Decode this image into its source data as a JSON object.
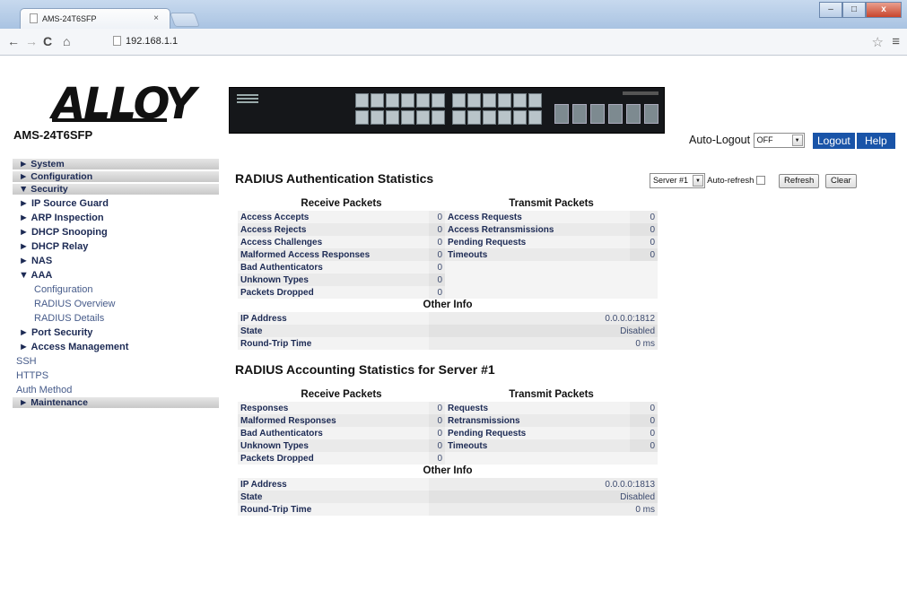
{
  "browser": {
    "tab_title": "AMS-24T6SFP",
    "tab_close": "×",
    "url": "192.168.1.1",
    "controls": {
      "back": "←",
      "forward": "→",
      "reload": "C",
      "home": "⌂",
      "star": "☆",
      "menu": "≡"
    },
    "window_buttons": {
      "minimize": "–",
      "maximize": "□",
      "close": "x"
    }
  },
  "header": {
    "logo_text": "ALLOY",
    "model": "AMS-24T6SFP",
    "auto_logout_label": "Auto-Logout",
    "auto_logout_value": "OFF",
    "logout_label": "Logout",
    "help_label": "Help"
  },
  "nav": {
    "system": "► System",
    "configuration": "► Configuration",
    "security": "▼ Security",
    "ip_source_guard": "► IP Source Guard",
    "arp_inspection": "► ARP Inspection",
    "dhcp_snooping": "► DHCP Snooping",
    "dhcp_relay": "► DHCP Relay",
    "nas": "► NAS",
    "aaa": "▼ AAA",
    "aaa_configuration": "Configuration",
    "radius_overview": "RADIUS Overview",
    "radius_details": "RADIUS Details",
    "port_security": "► Port Security",
    "access_management": "► Access Management",
    "ssh": "SSH",
    "https": "HTTPS",
    "auth_method": "Auth Method",
    "maintenance": "► Maintenance"
  },
  "controls": {
    "server_select": "Server #1",
    "auto_refresh_label": "Auto-refresh",
    "refresh_label": "Refresh",
    "clear_label": "Clear"
  },
  "auth": {
    "title": "RADIUS Authentication Statistics",
    "receive_header": "Receive Packets",
    "transmit_header": "Transmit Packets",
    "rows": [
      {
        "rx_label": "Access Accepts",
        "rx_value": "0",
        "tx_label": "Access Requests",
        "tx_value": "0"
      },
      {
        "rx_label": "Access Rejects",
        "rx_value": "0",
        "tx_label": "Access Retransmissions",
        "tx_value": "0"
      },
      {
        "rx_label": "Access Challenges",
        "rx_value": "0",
        "tx_label": "Pending Requests",
        "tx_value": "0"
      },
      {
        "rx_label": "Malformed Access Responses",
        "rx_value": "0",
        "tx_label": "Timeouts",
        "tx_value": "0"
      },
      {
        "rx_label": "Bad Authenticators",
        "rx_value": "0"
      },
      {
        "rx_label": "Unknown Types",
        "rx_value": "0"
      },
      {
        "rx_label": "Packets Dropped",
        "rx_value": "0"
      }
    ],
    "other_header": "Other Info",
    "ip_label": "IP Address",
    "ip_value": "0.0.0.0:1812",
    "state_label": "State",
    "state_value": "Disabled",
    "rtt_label": "Round-Trip Time",
    "rtt_value": "0 ms"
  },
  "acct": {
    "title": "RADIUS Accounting Statistics for Server #1",
    "receive_header": "Receive Packets",
    "transmit_header": "Transmit Packets",
    "rows": [
      {
        "rx_label": "Responses",
        "rx_value": "0",
        "tx_label": "Requests",
        "tx_value": "0"
      },
      {
        "rx_label": "Malformed Responses",
        "rx_value": "0",
        "tx_label": "Retransmissions",
        "tx_value": "0"
      },
      {
        "rx_label": "Bad Authenticators",
        "rx_value": "0",
        "tx_label": "Pending Requests",
        "tx_value": "0"
      },
      {
        "rx_label": "Unknown Types",
        "rx_value": "0",
        "tx_label": "Timeouts",
        "tx_value": "0"
      },
      {
        "rx_label": "Packets Dropped",
        "rx_value": "0"
      }
    ],
    "other_header": "Other Info",
    "ip_label": "IP Address",
    "ip_value": "0.0.0.0:1813",
    "state_label": "State",
    "state_value": "Disabled",
    "rtt_label": "Round-Trip Time",
    "rtt_value": "0 ms"
  }
}
